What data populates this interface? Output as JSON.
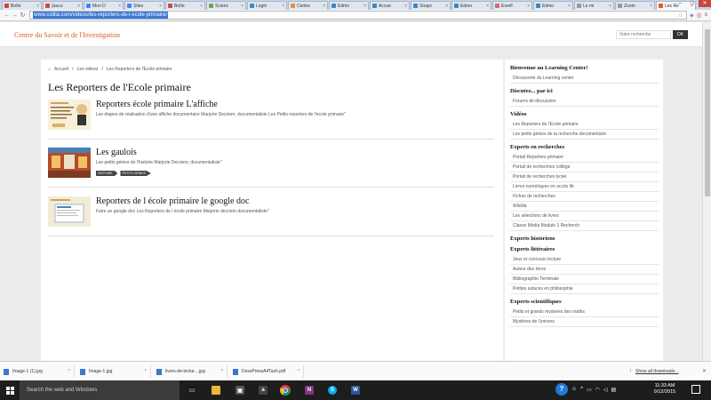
{
  "browser": {
    "tabs": [
      {
        "label": "Boîte",
        "color": "#d44638"
      },
      {
        "label": "(aucu",
        "color": "#d44638"
      },
      {
        "label": "Mon D",
        "color": "#4285f4"
      },
      {
        "label": "Sites",
        "color": "#4285f4"
      },
      {
        "label": "Boîte",
        "color": "#d44638"
      },
      {
        "label": "Scienc",
        "color": "#6aa84f"
      },
      {
        "label": "Login",
        "color": "#3d85c6"
      },
      {
        "label": "Centre",
        "color": "#e69138"
      },
      {
        "label": "Edmo",
        "color": "#3d85c6"
      },
      {
        "label": "Accue",
        "color": "#3d85c6"
      },
      {
        "label": "Snapc",
        "color": "#3d85c6"
      },
      {
        "label": "Edmo",
        "color": "#3d85c6"
      },
      {
        "label": "EverF",
        "color": "#e06666"
      },
      {
        "label": "Edmo",
        "color": "#3d85c6"
      },
      {
        "label": "Le mi",
        "color": "#999999"
      },
      {
        "label": "Zoom",
        "color": "#999999"
      },
      {
        "label": "Les Re",
        "color": "#e05a1f",
        "active": true
      }
    ],
    "url": "www.csillia.com/videos/les-reporters-de-l-ecole-primaire/"
  },
  "site": {
    "title": "Centre du Savoir et de l'Investigation",
    "search_placeholder": "Votre recherche",
    "search_button": "OK",
    "accent": "#e05a1f"
  },
  "breadcrumb": [
    "Accueil",
    "Les videos",
    "Les Reporters de l'Ecole primaire"
  ],
  "breadcrumb_sep": "/",
  "page_title": "Les Reporters de l'Ecole primaire",
  "items": [
    {
      "title": "Reporters école primaire L'affiche",
      "desc": "Les étapes de réalisation d'une affiche documentaire Marjorie Decriem, documentaliste Les Petits reporters de l'ecole primaire\"",
      "tags": []
    },
    {
      "title": "Les gaulois",
      "desc": "Les petits génies de l'histoire Marjorie Decriem, documentaliste\"",
      "tags": [
        "HISTOIRE",
        "PETITS GÉNIES"
      ]
    },
    {
      "title": "Reporters de l école primaire le google doc",
      "desc": "Faire un google doc Les Reporters de l école primaire Marjorie decriem documentaliste\"",
      "tags": []
    }
  ],
  "sidebar": [
    {
      "heading": "Bienvenue au Learning Center!",
      "links": [
        "Découverte du Learning center"
      ]
    },
    {
      "heading": "Discutez... par ici",
      "links": [
        "Forums de discussion"
      ]
    },
    {
      "heading": "Vidéos",
      "links": [
        "Les Reporters de l'Ecole primaire",
        "Les petits génies de la recherche documentaire"
      ]
    },
    {
      "heading": "Experts en recherches",
      "links": [
        "Portail Reporters primaire",
        "Portail de recherches collège",
        "Portail de recherches lycée",
        "Livres numériques en accès lib",
        "Fiches de recherches",
        "Wikilila",
        "Les sélections de livres",
        "Classe Média Module 1 Recherch"
      ]
    },
    {
      "heading": "Experts historiens",
      "links": []
    },
    {
      "heading": "Experts littéraires",
      "links": [
        "Jeux et concours lecture",
        "Autour des livres",
        "Bibliographie Terminale",
        "Petites astuces en philosophie"
      ]
    },
    {
      "heading": "Experts scientifiques",
      "links": [
        "Petits et grands mysteres des maths",
        "Mystères de l'univers"
      ]
    }
  ],
  "downloads": {
    "files": [
      "Image-1 (1).jpg",
      "Image-1.jpg",
      "livres-de-lectur....jpg",
      "DossPressA4Tach.pdf"
    ],
    "show_all": "Show all downloads..."
  },
  "taskbar": {
    "search_placeholder": "Search the web and Windows",
    "time": "11:33 AM",
    "date": "9/12/2015"
  }
}
